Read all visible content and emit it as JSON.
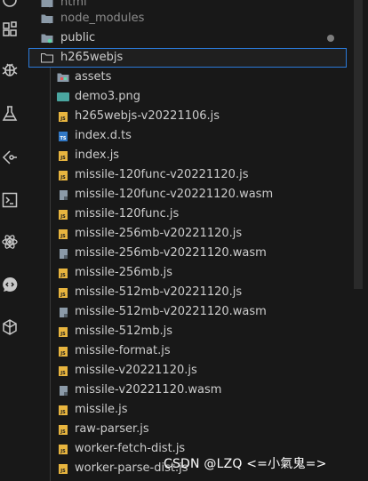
{
  "explorer": {
    "rows": [
      {
        "label": "html",
        "type": "folder"
      },
      {
        "label": "node_modules",
        "type": "folder"
      },
      {
        "label": "public",
        "type": "folder",
        "color": "#5fd7a8"
      },
      {
        "label": "h265webjs",
        "type": "folder-open"
      },
      {
        "label": "assets",
        "type": "folder-assets"
      },
      {
        "label": "demo3.png",
        "type": "png"
      },
      {
        "label": "h265webjs-v20221106.js",
        "type": "js"
      },
      {
        "label": "index.d.ts",
        "type": "ts"
      },
      {
        "label": "index.js",
        "type": "js"
      },
      {
        "label": "missile-120func-v20221120.js",
        "type": "js"
      },
      {
        "label": "missile-120func-v20221120.wasm",
        "type": "wasm"
      },
      {
        "label": "missile-120func.js",
        "type": "js"
      },
      {
        "label": "missile-256mb-v20221120.js",
        "type": "js"
      },
      {
        "label": "missile-256mb-v20221120.wasm",
        "type": "wasm"
      },
      {
        "label": "missile-256mb.js",
        "type": "js"
      },
      {
        "label": "missile-512mb-v20221120.js",
        "type": "js"
      },
      {
        "label": "missile-512mb-v20221120.wasm",
        "type": "wasm"
      },
      {
        "label": "missile-512mb.js",
        "type": "js"
      },
      {
        "label": "missile-format.js",
        "type": "js"
      },
      {
        "label": "missile-v20221120.js",
        "type": "js"
      },
      {
        "label": "missile-v20221120.wasm",
        "type": "wasm"
      },
      {
        "label": "missile.js",
        "type": "js"
      },
      {
        "label": "raw-parser.js",
        "type": "js"
      },
      {
        "label": "worker-fetch-dist.js",
        "type": "js"
      },
      {
        "label": "worker-parse-dist.js",
        "type": "js"
      }
    ],
    "selected_index": 3
  },
  "activity_bar": {
    "icons": [
      "accounts-icon",
      "extensions-icon",
      "debug-icon",
      "testing-icon",
      "git-icon",
      "terminal-icon",
      "react-icon",
      "live-share-icon",
      "remote-icon"
    ]
  },
  "watermark": "CSDN @LZQ <=小氣鬼=>",
  "colors": {
    "background": "#181818",
    "text": "#cccccc",
    "public_folder": "#5fd7a8",
    "selection_border": "#2b79d8",
    "js_icon": "#e8b53f",
    "ts_icon": "#3178c6",
    "wasm_icon": "#8b9aa8",
    "png_icon": "#4aa6a0"
  }
}
